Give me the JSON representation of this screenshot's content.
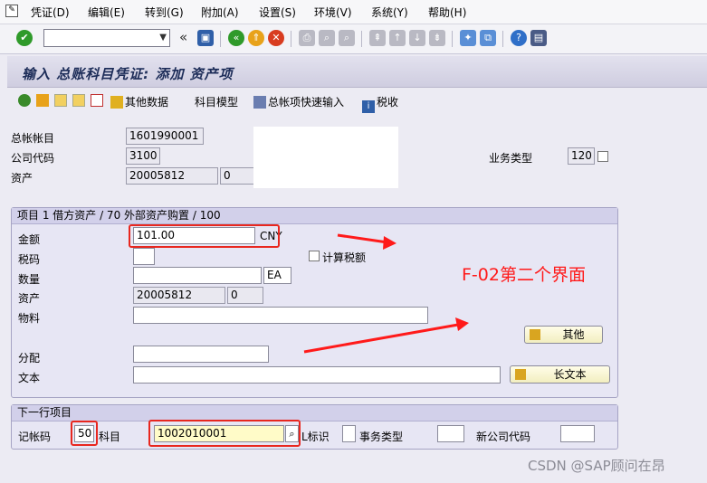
{
  "menu": {
    "items": [
      "凭证(D)",
      "编辑(E)",
      "转到(G)",
      "附加(A)",
      "设置(S)",
      "环境(V)",
      "系统(Y)",
      "帮助(H)"
    ]
  },
  "toolbar": {
    "command_value": "",
    "double_arrow": "«"
  },
  "screen": {
    "title": "输入 总账科目凭证: 添加 资产项"
  },
  "app_toolbar": {
    "other_data": "其他数据",
    "account_model": "科目模型",
    "gl_fast_entry": "总帐项快速输入",
    "tax": "税收"
  },
  "header": {
    "gl_account_label": "总帐帐目",
    "gl_account_value": "1601990001",
    "company_code_label": "公司代码",
    "company_code_value": "3100",
    "asset_label": "资产",
    "asset_value": "20005812",
    "asset_sub_value": "0",
    "trans_type_label": "业务类型",
    "trans_type_value": "120"
  },
  "item": {
    "heading": "项目 1 借方资产 / 70 外部资产购置 / 100",
    "amount_label": "金额",
    "amount_value": "101.00",
    "currency": "CNY",
    "tax_code_label": "税码",
    "tax_code_value": "",
    "calc_tax_label": "计算税额",
    "quantity_label": "数量",
    "quantity_value": "",
    "unit": "EA",
    "asset_label": "资产",
    "asset_value": "20005812",
    "asset_sub_value": "0",
    "material_label": "物料",
    "material_value": "",
    "assignment_label": "分配",
    "assignment_value": "",
    "text_label": "文本",
    "text_value": "",
    "more_button": "其他",
    "long_text_button": "长文本"
  },
  "next_item": {
    "heading": "下一行项目",
    "posting_key_label": "记帐码",
    "posting_key_value": "50",
    "account_label": "科目",
    "account_value": "1002010001",
    "sgl_ind_label": "L标识",
    "trans_type_label": "事务类型",
    "new_company_label": "新公司代码"
  },
  "annotation": {
    "text": "F-02第二个界面",
    "color": "#ff1a1a"
  },
  "watermark": "CSDN @SAP顾问在昂"
}
